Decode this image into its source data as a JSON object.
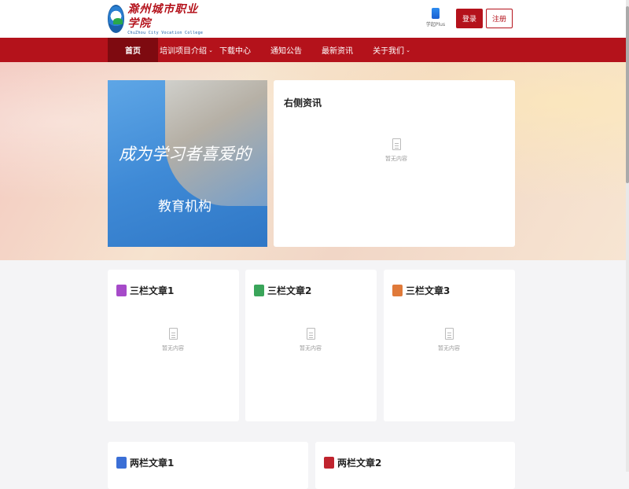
{
  "header": {
    "logo_cn": "滁州城市职业学院",
    "logo_en": "ChuZhou City Vocation College",
    "app_label": "学起Plus",
    "login_label": "登录",
    "register_label": "注册"
  },
  "nav": {
    "items": [
      {
        "label": "首页",
        "active": true
      },
      {
        "label": "培训项目介绍",
        "dropdown": true
      },
      {
        "label": "下载中心"
      },
      {
        "label": "通知公告"
      },
      {
        "label": "最新资讯"
      },
      {
        "label": "关于我们",
        "dropdown": true
      }
    ],
    "caret": "⌄"
  },
  "banner": {
    "slogan": "成为学习者喜爱的",
    "subtitle": "教育机构"
  },
  "right_news": {
    "title": "右侧资讯",
    "empty_text": "暂无内容"
  },
  "columns": [
    {
      "title": "三栏文章1",
      "icon": "purple-doc-icon",
      "color": "#a64ac9",
      "empty_text": "暂无内容"
    },
    {
      "title": "三栏文章2",
      "icon": "green-doc-icon",
      "color": "#3aa55a",
      "empty_text": "暂无内容"
    },
    {
      "title": "三栏文章3",
      "icon": "list-doc-icon",
      "color": "#e07a3a",
      "empty_text": "暂无内容"
    }
  ],
  "two_columns": [
    {
      "title": "两栏文章1",
      "icon": "blue-doc-icon",
      "color": "#3b6fd6"
    },
    {
      "title": "两栏文章2",
      "icon": "red-doc-icon",
      "color": "#c0242e"
    }
  ],
  "colors": {
    "brand_red": "#b4121b",
    "nav_active": "#7e0a10"
  }
}
